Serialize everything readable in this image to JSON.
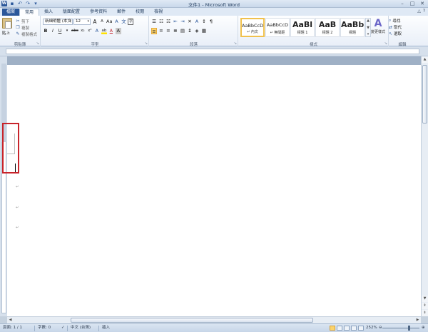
{
  "window": {
    "title": "文件1 - Microsoft Word"
  },
  "tabs": [
    {
      "label": "檔案"
    },
    {
      "label": "常用"
    },
    {
      "label": "插入"
    },
    {
      "label": "版面配置"
    },
    {
      "label": "參考資料"
    },
    {
      "label": "郵件"
    },
    {
      "label": "校閱"
    },
    {
      "label": "檢視"
    }
  ],
  "clipboard": {
    "paste_label": "貼上",
    "cut_label": "剪下",
    "copy_label": "複製",
    "format_painter_label": "複製格式",
    "group_label": "剪貼簿"
  },
  "font": {
    "font_name": "新細明體 (本文",
    "font_size": "12",
    "grow": "A",
    "shrink": "A",
    "change_case": "Aa",
    "clear_format": "A",
    "group_label": "字型",
    "bold": "B",
    "italic": "I",
    "underline": "U",
    "strike": "abc",
    "subscript": "x₂",
    "superscript": "x²",
    "text_effects": "A",
    "highlight": "ab",
    "font_color": "A",
    "char_shading": "A",
    "enclose": "字"
  },
  "paragraph": {
    "group_label": "段落"
  },
  "styles": {
    "group_label": "樣式",
    "tiles": [
      {
        "sample": "AaBbCcD",
        "name": "↵ 內文"
      },
      {
        "sample": "AaBbCcD",
        "name": "↵ 無間距"
      },
      {
        "sample": "AaBl",
        "name": "標題 1"
      },
      {
        "sample": "AaB",
        "name": "標題 2"
      },
      {
        "sample": "AaBbC",
        "name": "標題"
      }
    ],
    "change_styles_label": "變更樣式"
  },
  "editing": {
    "group_label": "編輯",
    "find_label": "尋找",
    "replace_label": "取代",
    "select_label": "選取"
  },
  "document": {
    "paragraph_marks": [
      "↵",
      "↵",
      "↵"
    ]
  },
  "status": {
    "page": "頁面: 1 / 1",
    "words": "字數: 0",
    "language": "中文 (台灣)",
    "insert_mode": "插入",
    "zoom": "252%"
  },
  "colors": {
    "brand": "#2b579a",
    "highlight_border": "#c8242b",
    "selected_style_border": "#f0c14d"
  }
}
